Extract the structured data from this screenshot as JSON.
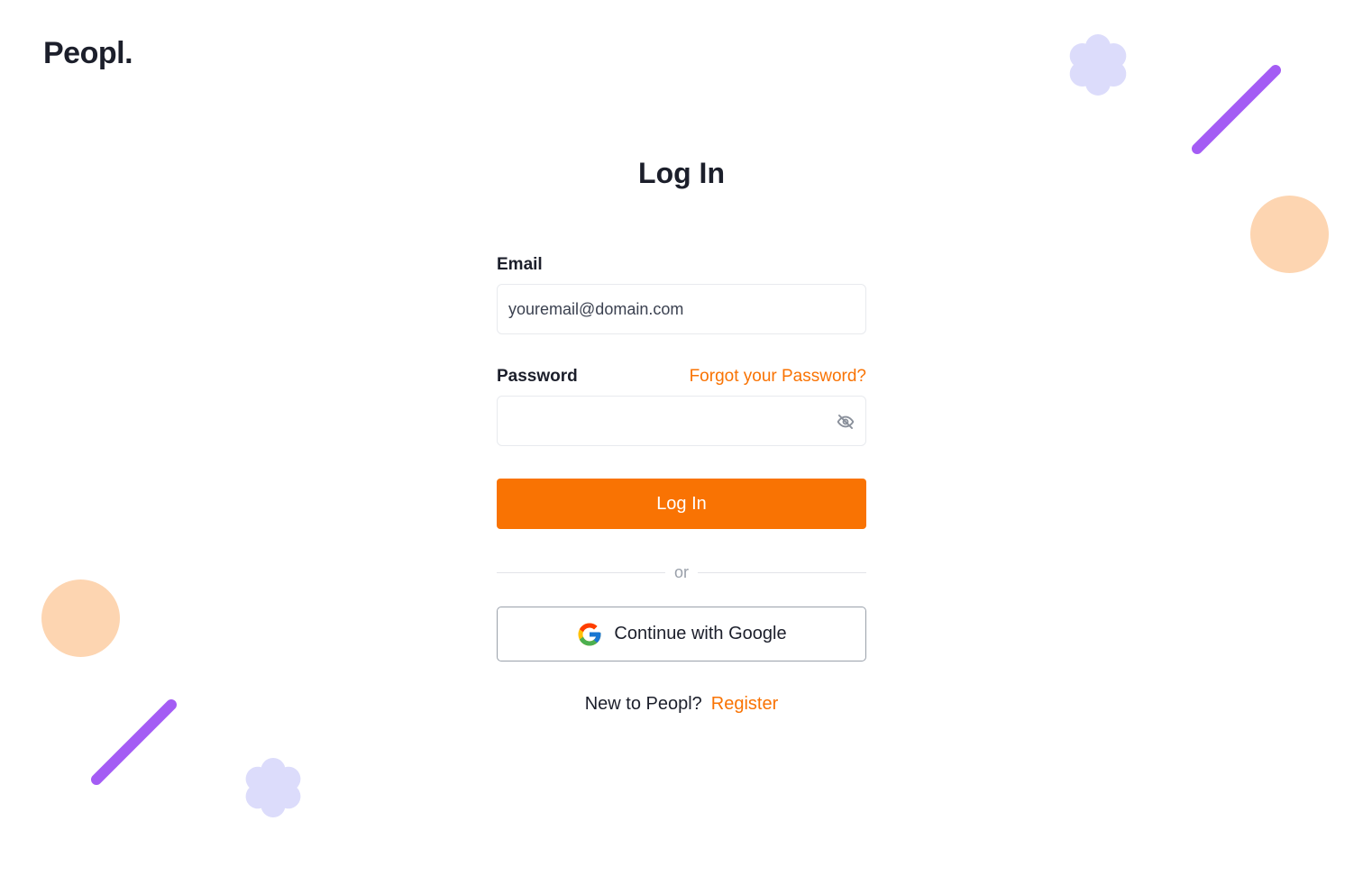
{
  "brand": {
    "logo_text": "Peopl."
  },
  "page": {
    "title": "Log In"
  },
  "form": {
    "email_label": "Email",
    "email_placeholder": "youremail@domain.com",
    "email_value": "",
    "password_label": "Password",
    "forgot_link": "Forgot your Password?",
    "password_value": "",
    "password_toggle_icon": "eye-slash-icon",
    "login_button": "Log In",
    "divider_text": "or",
    "google_button": "Continue with Google",
    "google_icon": "google-g-icon",
    "register_prompt": "New to Peopl?",
    "register_link": "Register"
  },
  "colors": {
    "accent": "#f97303",
    "text": "#1c1f2b",
    "decor_purple": "#a45cf4",
    "decor_lavender": "#dcdcfb",
    "decor_peach": "#fdd5b1"
  }
}
